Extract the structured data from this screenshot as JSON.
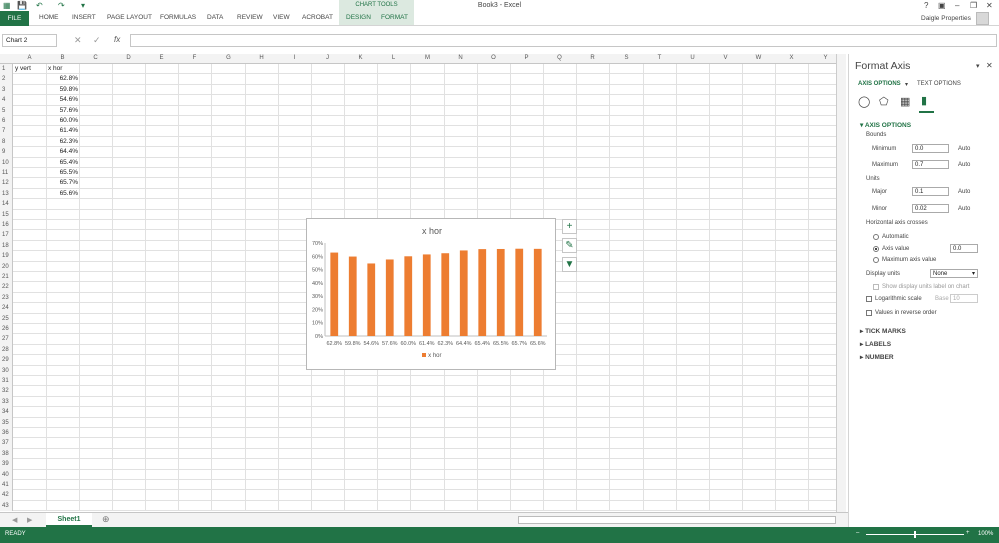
{
  "window": {
    "title": "Book3 - Excel",
    "chart_tools_label": "CHART TOOLS",
    "user": "Daigle Properties"
  },
  "ribbon": {
    "tabs": [
      "HOME",
      "INSERT",
      "PAGE LAYOUT",
      "FORMULAS",
      "DATA",
      "REVIEW",
      "VIEW",
      "ACROBAT",
      "DESIGN",
      "FORMAT"
    ],
    "file_label": "FILE"
  },
  "formula_bar": {
    "name_box": "Chart 2",
    "fx": "fx",
    "value": ""
  },
  "sheet": {
    "columns": [
      "A",
      "B",
      "C",
      "D",
      "E",
      "F",
      "G",
      "H",
      "I",
      "J",
      "K",
      "L",
      "M",
      "N",
      "O",
      "P",
      "Q",
      "R",
      "S",
      "T",
      "U",
      "V",
      "W",
      "X",
      "Y"
    ],
    "rows": [
      "1",
      "2",
      "3",
      "4",
      "5",
      "6",
      "7",
      "8",
      "9",
      "10",
      "11",
      "12",
      "13",
      "14",
      "15",
      "16",
      "17",
      "18",
      "19",
      "20",
      "21",
      "22",
      "23",
      "24",
      "25",
      "26",
      "27",
      "28",
      "29",
      "30",
      "31",
      "32",
      "33",
      "34",
      "35",
      "36",
      "37",
      "38",
      "39",
      "40",
      "41",
      "42",
      "43"
    ],
    "a1": "y vert",
    "b1": "x hor",
    "b_values": [
      "62.8%",
      "59.8%",
      "54.6%",
      "57.6%",
      "60.0%",
      "61.4%",
      "62.3%",
      "64.4%",
      "65.4%",
      "65.5%",
      "65.7%",
      "65.6%"
    ],
    "tab_name": "Sheet1"
  },
  "chart": {
    "title": "x hor",
    "legend": "x hor",
    "bar_color": "#ed7d31",
    "y_ticks": [
      "70%",
      "60%",
      "50%",
      "40%",
      "30%",
      "20%",
      "10%",
      "0%"
    ],
    "categories": [
      "62.8%",
      "59.8%",
      "54.6%",
      "57.6%",
      "60.0%",
      "61.4%",
      "62.3%",
      "64.4%",
      "65.4%",
      "65.5%",
      "65.7%",
      "65.6%"
    ],
    "values": [
      0.628,
      0.598,
      0.546,
      0.576,
      0.6,
      0.614,
      0.623,
      0.644,
      0.654,
      0.655,
      0.657,
      0.656
    ],
    "ylim": [
      0,
      0.7
    ]
  },
  "pane": {
    "title": "Format Axis",
    "tab_axis": "AXIS OPTIONS",
    "tab_text": "TEXT OPTIONS",
    "section": "AXIS OPTIONS",
    "bounds": "Bounds",
    "minimum": "Minimum",
    "minimum_value": "0.0",
    "maximum": "Maximum",
    "maximum_value": "0.7",
    "auto": "Auto",
    "units": "Units",
    "major": "Major",
    "major_value": "0.1",
    "minor": "Minor",
    "minor_value": "0.02",
    "crosses": "Horizontal axis crosses",
    "automatic": "Automatic",
    "axis_value": "Axis value",
    "axis_value_input": "0.0",
    "max_axis_value": "Maximum axis value",
    "display_units": "Display units",
    "display_units_value": "None",
    "show_label": "Show display units label on chart",
    "log_scale": "Logarithmic scale",
    "base": "Base",
    "base_value": "10",
    "reverse": "Values in reverse order",
    "tick_marks": "TICK MARKS",
    "labels": "LABELS",
    "number": "NUMBER"
  },
  "status": {
    "ready": "READY",
    "zoom": "100%"
  }
}
